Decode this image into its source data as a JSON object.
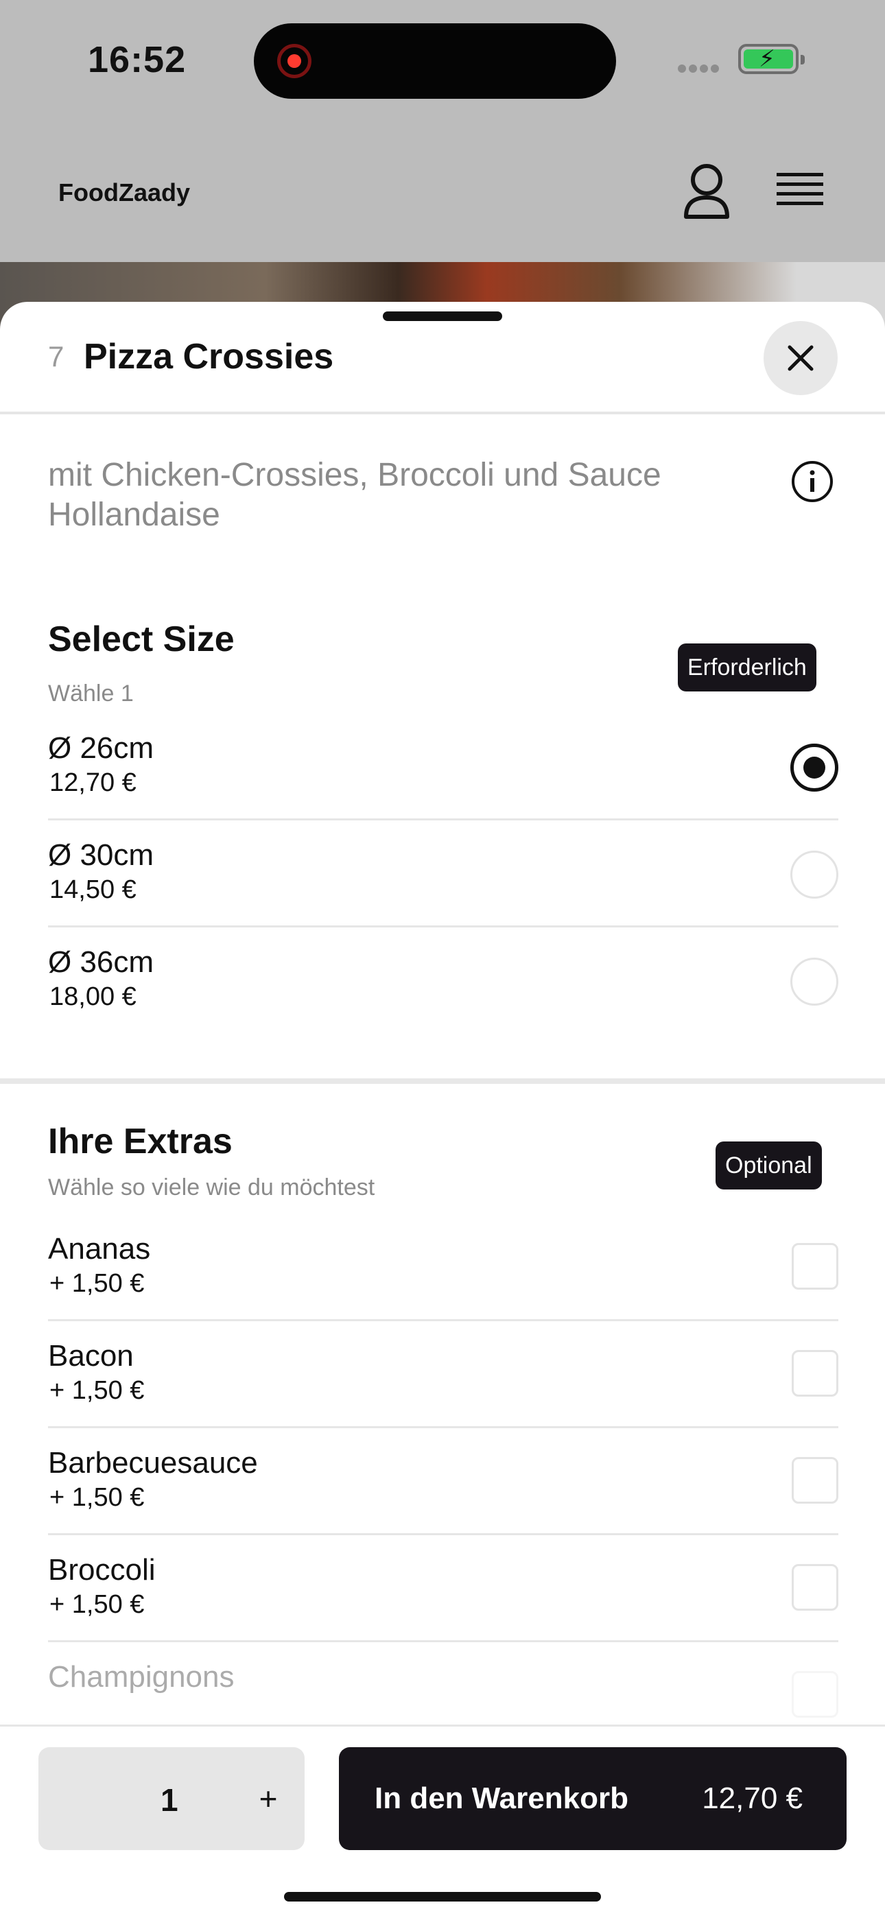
{
  "status": {
    "time": "16:52"
  },
  "header": {
    "brand": "FoodZaady"
  },
  "item": {
    "number": "7",
    "title": "Pizza Crossies",
    "description": "mit Chicken-Crossies, Broccoli und Sauce Hollandaise"
  },
  "size_section": {
    "title": "Select Size",
    "subtitle": "Wähle 1",
    "badge": "Erforderlich",
    "options": [
      {
        "name": "Ø 26cm",
        "price": "12,70 €",
        "selected": true
      },
      {
        "name": "Ø 30cm",
        "price": "14,50 €",
        "selected": false
      },
      {
        "name": "Ø 36cm",
        "price": "18,00 €",
        "selected": false
      }
    ]
  },
  "extras_section": {
    "title": "Ihre Extras",
    "subtitle": "Wähle so viele wie du möchtest",
    "badge": "Optional",
    "options": [
      {
        "name": "Ananas",
        "price": "+ 1,50 €"
      },
      {
        "name": "Bacon",
        "price": "+ 1,50 €"
      },
      {
        "name": "Barbecuesauce",
        "price": "+ 1,50 €"
      },
      {
        "name": "Broccoli",
        "price": "+ 1,50 €"
      },
      {
        "name": "Champignons",
        "price": ""
      }
    ]
  },
  "bottom": {
    "quantity": "1",
    "plus": "+",
    "cart_label": "In den Warenkorb",
    "cart_price": "12,70 €"
  },
  "icons": [
    "record-icon",
    "battery-icon",
    "user-icon",
    "menu-icon",
    "close-icon",
    "info-icon"
  ]
}
